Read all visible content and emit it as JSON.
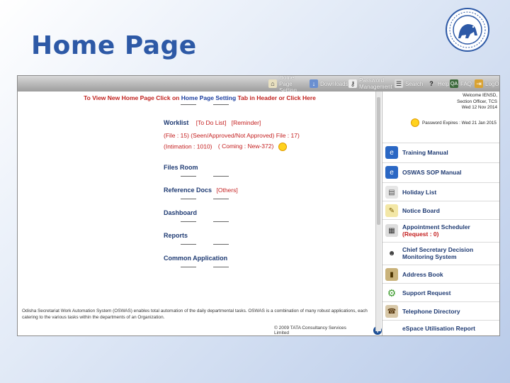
{
  "slide": {
    "title": "Home Page"
  },
  "topbar": {
    "items": [
      {
        "label": "Home Page Setting",
        "icon": "home-setting-icon"
      },
      {
        "label": "Downloads",
        "icon": "download-icon"
      },
      {
        "label": "Password Management",
        "icon": "key-icon"
      },
      {
        "label": "Search",
        "icon": "search-icon"
      },
      {
        "label": "Help",
        "icon": "help-icon"
      },
      {
        "label": "FAQ",
        "icon": "faq-icon"
      },
      {
        "label": "LogO",
        "icon": "logout-icon"
      }
    ]
  },
  "banner": {
    "part1": "To View New Home Page Click on ",
    "link": "Home Page Setting",
    "part2": " Tab in Header or Click Here"
  },
  "menu": {
    "worklist": {
      "heading": "Worklist",
      "todo": "[To Do List]",
      "reminder": "[Reminder]",
      "line2": "(File : 15) (Seen/Approved/Not Approved) File : 17)",
      "intimation": "(Intimation : 1010)",
      "coming": "( Coming : New-372)"
    },
    "files_room": "Files Room",
    "reference_docs": "Reference Docs",
    "reference_others": "[Others]",
    "dashboard": "Dashboard",
    "reports": "Reports",
    "common_application": "Common Application"
  },
  "footer": {
    "description": "Odisha Secretariat Work Automation System (OSWAS) enables total automation of the daily departmental tasks. OSWAS is a combination of many robust applications, each catering to the various tasks within the departments of an Organization.",
    "copyright": "© 2009 TATA Consultancy Services Limited"
  },
  "sidebar": {
    "welcome_line1": "Welcome IENSD,",
    "welcome_line2": "Section Officer, TCS",
    "welcome_line3": "Wed 12 Nov 2014",
    "password_expires": "Password Expires : Wed 21 Jan 2015",
    "items": [
      {
        "label": "Training Manual",
        "icon": "training-manual-icon"
      },
      {
        "label": "OSWAS SOP Manual",
        "icon": "sop-manual-icon"
      },
      {
        "label": "Holiday List",
        "icon": "holiday-list-icon"
      },
      {
        "label": "Notice Board",
        "icon": "notice-board-icon"
      },
      {
        "label": "Appointment Scheduler",
        "extra": "(Request : 0)",
        "icon": "calendar-icon"
      },
      {
        "label": "Chief Secretary Decision Monitoring System",
        "icon": "people-icon"
      },
      {
        "label": "Address Book",
        "icon": "address-book-icon"
      },
      {
        "label": "Support Request",
        "icon": "support-gear-icon"
      },
      {
        "label": "Telephone Directory",
        "icon": "telephone-icon"
      },
      {
        "label": "eSpace Utilisation Report",
        "icon": "report-icon"
      }
    ]
  },
  "colors": {
    "title": "#2d59a6",
    "link_red": "#c42020",
    "heading_navy": "#1f3b73"
  }
}
